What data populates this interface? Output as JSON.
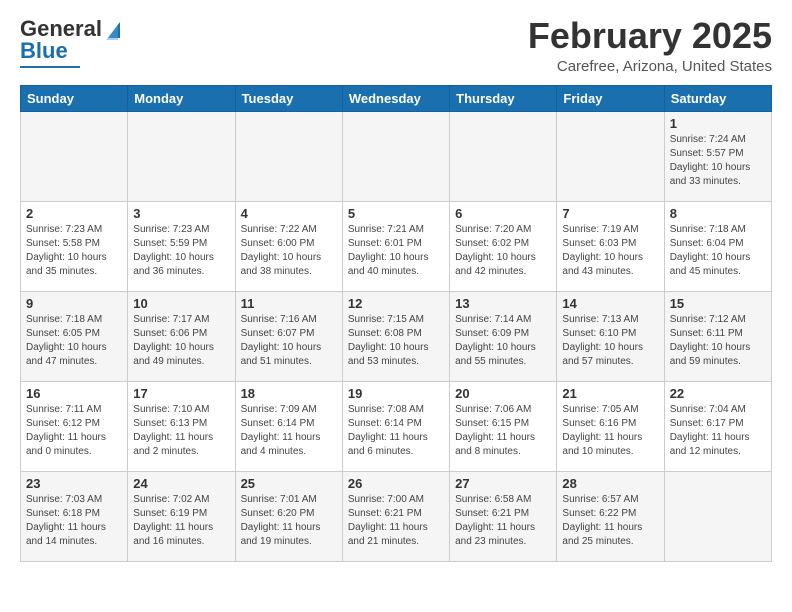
{
  "logo": {
    "line1": "General",
    "line2": "Blue"
  },
  "header": {
    "title": "February 2025",
    "subtitle": "Carefree, Arizona, United States"
  },
  "weekdays": [
    "Sunday",
    "Monday",
    "Tuesday",
    "Wednesday",
    "Thursday",
    "Friday",
    "Saturday"
  ],
  "weeks": [
    [
      {
        "day": "",
        "info": ""
      },
      {
        "day": "",
        "info": ""
      },
      {
        "day": "",
        "info": ""
      },
      {
        "day": "",
        "info": ""
      },
      {
        "day": "",
        "info": ""
      },
      {
        "day": "",
        "info": ""
      },
      {
        "day": "1",
        "info": "Sunrise: 7:24 AM\nSunset: 5:57 PM\nDaylight: 10 hours\nand 33 minutes."
      }
    ],
    [
      {
        "day": "2",
        "info": "Sunrise: 7:23 AM\nSunset: 5:58 PM\nDaylight: 10 hours\nand 35 minutes."
      },
      {
        "day": "3",
        "info": "Sunrise: 7:23 AM\nSunset: 5:59 PM\nDaylight: 10 hours\nand 36 minutes."
      },
      {
        "day": "4",
        "info": "Sunrise: 7:22 AM\nSunset: 6:00 PM\nDaylight: 10 hours\nand 38 minutes."
      },
      {
        "day": "5",
        "info": "Sunrise: 7:21 AM\nSunset: 6:01 PM\nDaylight: 10 hours\nand 40 minutes."
      },
      {
        "day": "6",
        "info": "Sunrise: 7:20 AM\nSunset: 6:02 PM\nDaylight: 10 hours\nand 42 minutes."
      },
      {
        "day": "7",
        "info": "Sunrise: 7:19 AM\nSunset: 6:03 PM\nDaylight: 10 hours\nand 43 minutes."
      },
      {
        "day": "8",
        "info": "Sunrise: 7:18 AM\nSunset: 6:04 PM\nDaylight: 10 hours\nand 45 minutes."
      }
    ],
    [
      {
        "day": "9",
        "info": "Sunrise: 7:18 AM\nSunset: 6:05 PM\nDaylight: 10 hours\nand 47 minutes."
      },
      {
        "day": "10",
        "info": "Sunrise: 7:17 AM\nSunset: 6:06 PM\nDaylight: 10 hours\nand 49 minutes."
      },
      {
        "day": "11",
        "info": "Sunrise: 7:16 AM\nSunset: 6:07 PM\nDaylight: 10 hours\nand 51 minutes."
      },
      {
        "day": "12",
        "info": "Sunrise: 7:15 AM\nSunset: 6:08 PM\nDaylight: 10 hours\nand 53 minutes."
      },
      {
        "day": "13",
        "info": "Sunrise: 7:14 AM\nSunset: 6:09 PM\nDaylight: 10 hours\nand 55 minutes."
      },
      {
        "day": "14",
        "info": "Sunrise: 7:13 AM\nSunset: 6:10 PM\nDaylight: 10 hours\nand 57 minutes."
      },
      {
        "day": "15",
        "info": "Sunrise: 7:12 AM\nSunset: 6:11 PM\nDaylight: 10 hours\nand 59 minutes."
      }
    ],
    [
      {
        "day": "16",
        "info": "Sunrise: 7:11 AM\nSunset: 6:12 PM\nDaylight: 11 hours\nand 0 minutes."
      },
      {
        "day": "17",
        "info": "Sunrise: 7:10 AM\nSunset: 6:13 PM\nDaylight: 11 hours\nand 2 minutes."
      },
      {
        "day": "18",
        "info": "Sunrise: 7:09 AM\nSunset: 6:14 PM\nDaylight: 11 hours\nand 4 minutes."
      },
      {
        "day": "19",
        "info": "Sunrise: 7:08 AM\nSunset: 6:14 PM\nDaylight: 11 hours\nand 6 minutes."
      },
      {
        "day": "20",
        "info": "Sunrise: 7:06 AM\nSunset: 6:15 PM\nDaylight: 11 hours\nand 8 minutes."
      },
      {
        "day": "21",
        "info": "Sunrise: 7:05 AM\nSunset: 6:16 PM\nDaylight: 11 hours\nand 10 minutes."
      },
      {
        "day": "22",
        "info": "Sunrise: 7:04 AM\nSunset: 6:17 PM\nDaylight: 11 hours\nand 12 minutes."
      }
    ],
    [
      {
        "day": "23",
        "info": "Sunrise: 7:03 AM\nSunset: 6:18 PM\nDaylight: 11 hours\nand 14 minutes."
      },
      {
        "day": "24",
        "info": "Sunrise: 7:02 AM\nSunset: 6:19 PM\nDaylight: 11 hours\nand 16 minutes."
      },
      {
        "day": "25",
        "info": "Sunrise: 7:01 AM\nSunset: 6:20 PM\nDaylight: 11 hours\nand 19 minutes."
      },
      {
        "day": "26",
        "info": "Sunrise: 7:00 AM\nSunset: 6:21 PM\nDaylight: 11 hours\nand 21 minutes."
      },
      {
        "day": "27",
        "info": "Sunrise: 6:58 AM\nSunset: 6:21 PM\nDaylight: 11 hours\nand 23 minutes."
      },
      {
        "day": "28",
        "info": "Sunrise: 6:57 AM\nSunset: 6:22 PM\nDaylight: 11 hours\nand 25 minutes."
      },
      {
        "day": "",
        "info": ""
      }
    ]
  ]
}
